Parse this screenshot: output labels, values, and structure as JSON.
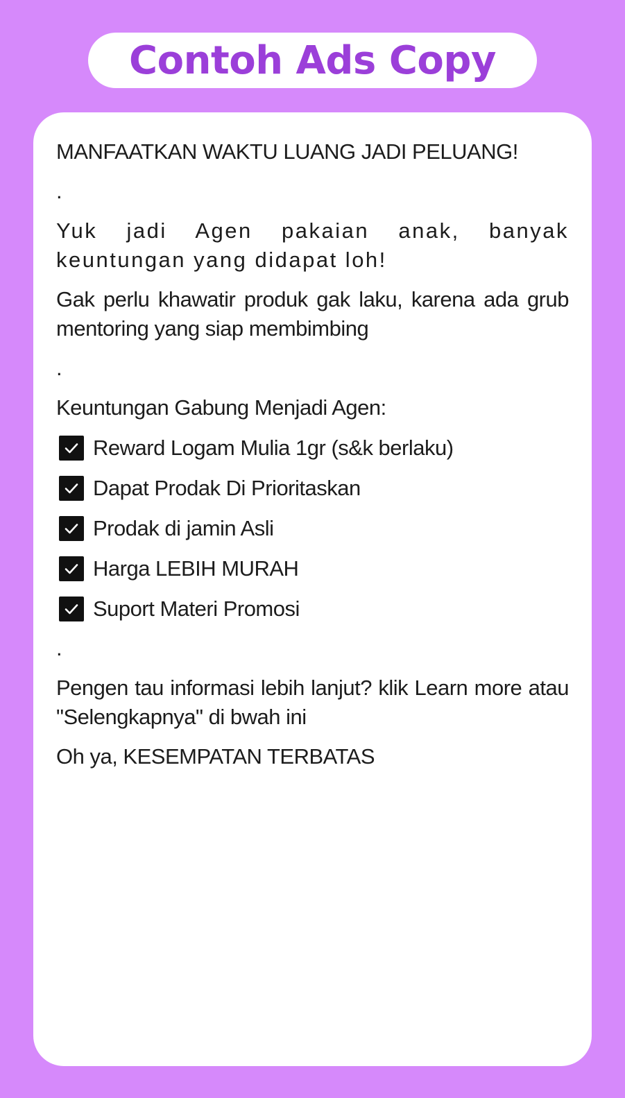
{
  "header": {
    "title": "Contoh Ads Copy"
  },
  "colors": {
    "background": "#d689fb",
    "title_text": "#9b3fd9",
    "card": "#ffffff",
    "body_text": "#1c1c1c"
  },
  "ad": {
    "headline": "MANFAATKAN WAKTU LUANG JADI PELUANG!",
    "separator": ".",
    "intro": "Yuk jadi Agen pakaian anak, banyak keuntungan yang didapat loh!",
    "reassurance": "Gak perlu khawatir produk gak laku, karena ada grub mentoring yang siap membimbing",
    "benefits_heading": "Keuntungan Gabung Menjadi Agen:",
    "benefit_icon": "check-mark-icon",
    "benefits": [
      "Reward Logam Mulia 1gr (s&k berlaku)",
      "Dapat Prodak Di Prioritaskan",
      "Prodak di jamin Asli",
      "Harga LEBIH MURAH",
      "Suport Materi Promosi"
    ],
    "cta": "Pengen tau informasi lebih lanjut? klik Learn more atau \"Selengkapnya\" di bwah ini",
    "closing": "Oh ya, KESEMPATAN TERBATAS"
  }
}
